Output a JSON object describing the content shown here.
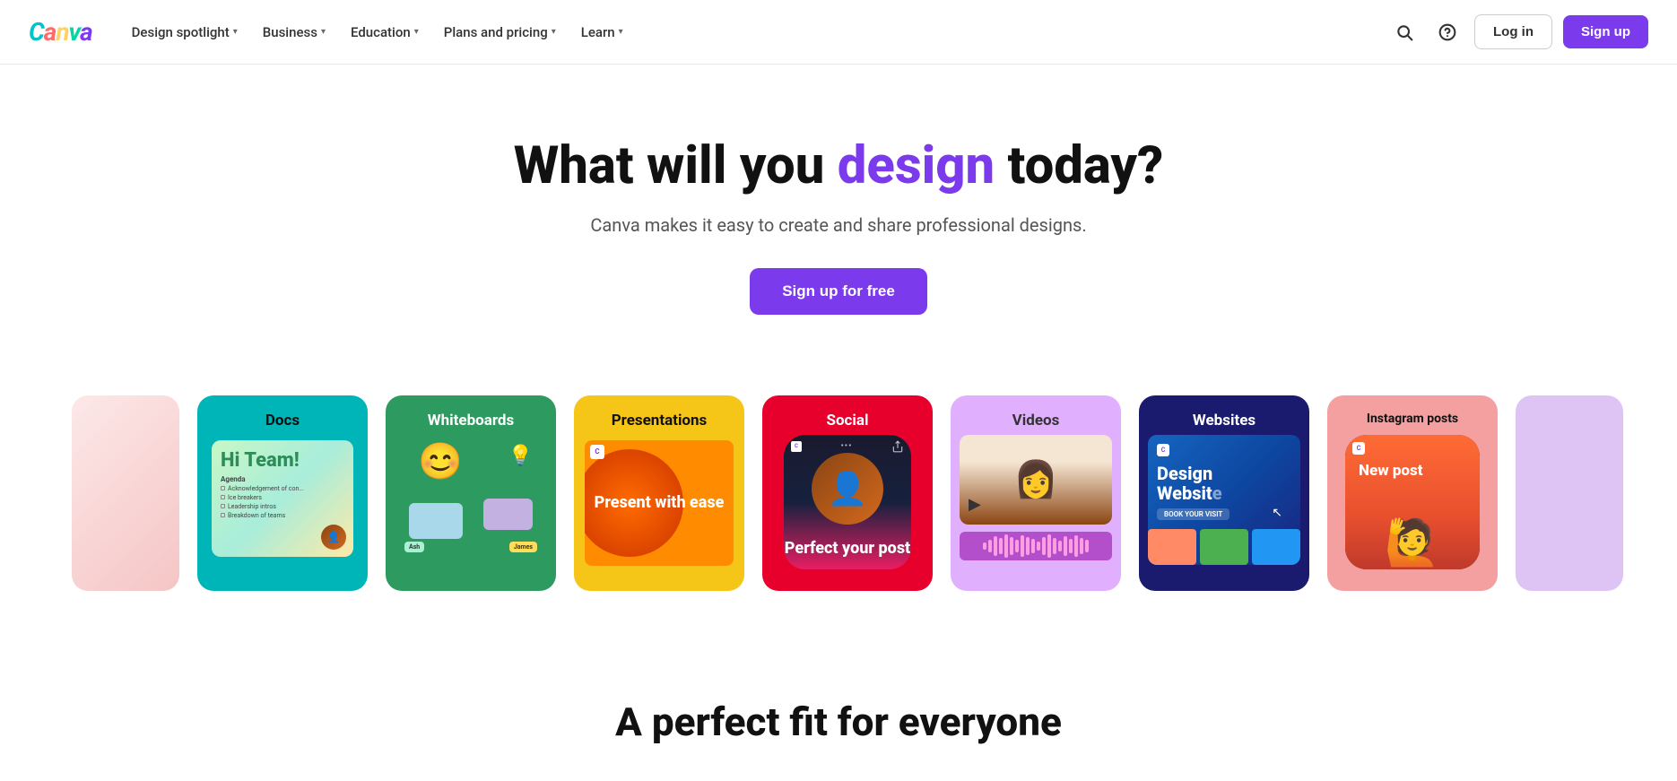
{
  "navbar": {
    "logo": "Canva",
    "nav_items": [
      {
        "label": "Design spotlight",
        "has_dropdown": true
      },
      {
        "label": "Business",
        "has_dropdown": true
      },
      {
        "label": "Education",
        "has_dropdown": true
      },
      {
        "label": "Plans and pricing",
        "has_dropdown": true
      },
      {
        "label": "Learn",
        "has_dropdown": true
      }
    ],
    "login_label": "Log in",
    "signup_label": "Sign up"
  },
  "hero": {
    "headline_part1": "What will you ",
    "headline_highlight": "design",
    "headline_part2": " today?",
    "subtitle": "Canva makes it easy to create and share professional designs.",
    "cta_label": "Sign up for free"
  },
  "cards": [
    {
      "id": "docs",
      "label": "Docs",
      "sublabel": ""
    },
    {
      "id": "whiteboards",
      "label": "Whiteboards",
      "sublabel": ""
    },
    {
      "id": "presentations",
      "label": "Presentations",
      "sublabel": "Present with ease"
    },
    {
      "id": "social",
      "label": "Social",
      "sublabel": "Perfect your post"
    },
    {
      "id": "videos",
      "label": "Videos",
      "sublabel": ""
    },
    {
      "id": "websites",
      "label": "Websites",
      "sublabel": "Design Website"
    },
    {
      "id": "instagram",
      "label": "Instagram posts",
      "sublabel": "New post"
    }
  ],
  "bottom_section": {
    "heading": "A perfect fit for everyone"
  },
  "waveform_bars": [
    8,
    14,
    22,
    18,
    26,
    20,
    14,
    24,
    20,
    16,
    10,
    20,
    26,
    18,
    12,
    22,
    16,
    24,
    18,
    14
  ],
  "colors": {
    "primary": "#7c3aed",
    "docs_bg": "#00b5b8",
    "wb_bg": "#2d9a5f",
    "pres_bg": "#f5c518",
    "social_bg": "#e8002d",
    "videos_bg": "#e0b0ff",
    "web_bg": "#1a1a6e",
    "ig_bg": "#f4a0a0"
  }
}
